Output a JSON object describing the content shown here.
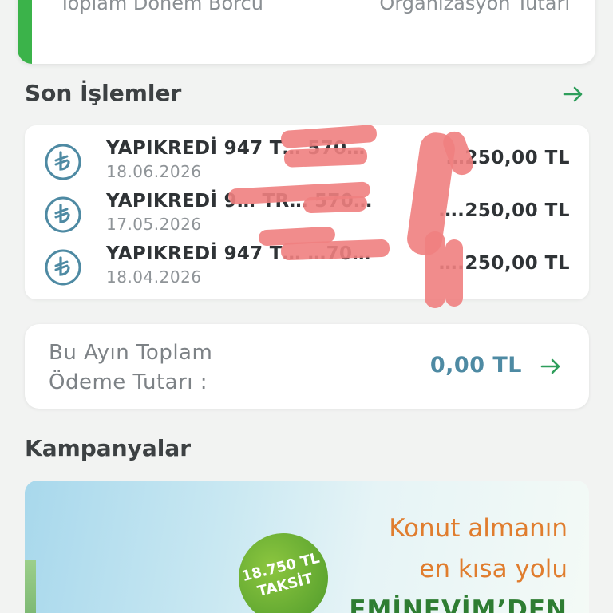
{
  "summary": {
    "left_label": "Toplam Dönem Borcu",
    "right_label": "Organizasyon Tutarı"
  },
  "recent": {
    "title": "Son İşlemler",
    "transactions": [
      {
        "name": "YAPIKREDİ 947 T…          570…",
        "date": "18.06.2026",
        "amount": "…250,00 TL",
        "icon": "lira-icon"
      },
      {
        "name": "YAPIKREDİ 9… TR…          570…",
        "date": "17.05.2026",
        "amount": "….250,00 TL",
        "icon": "lira-icon"
      },
      {
        "name": "YAPIKREDİ 947 T…          …70…",
        "date": "18.04.2026",
        "amount": "….250,00 TL",
        "icon": "lira-icon"
      }
    ]
  },
  "payment": {
    "label_line1": "Bu Ayın Toplam",
    "label_line2": "Ödeme Tutarı :",
    "amount": "0,00 TL"
  },
  "campaigns": {
    "title": "Kampanyalar",
    "badge_line1": "18.750 TL",
    "badge_line2": "TAKSİT",
    "promo_line1": "Konut almanın",
    "promo_line2": "en kısa yolu",
    "promo_line3": "EMİNEVİM’DEN"
  },
  "colors": {
    "accent_green": "#3bb34a",
    "amount_blue": "#4e8aa3",
    "arrow_green": "#2e9e5b",
    "promo_orange": "#e07d2e"
  }
}
